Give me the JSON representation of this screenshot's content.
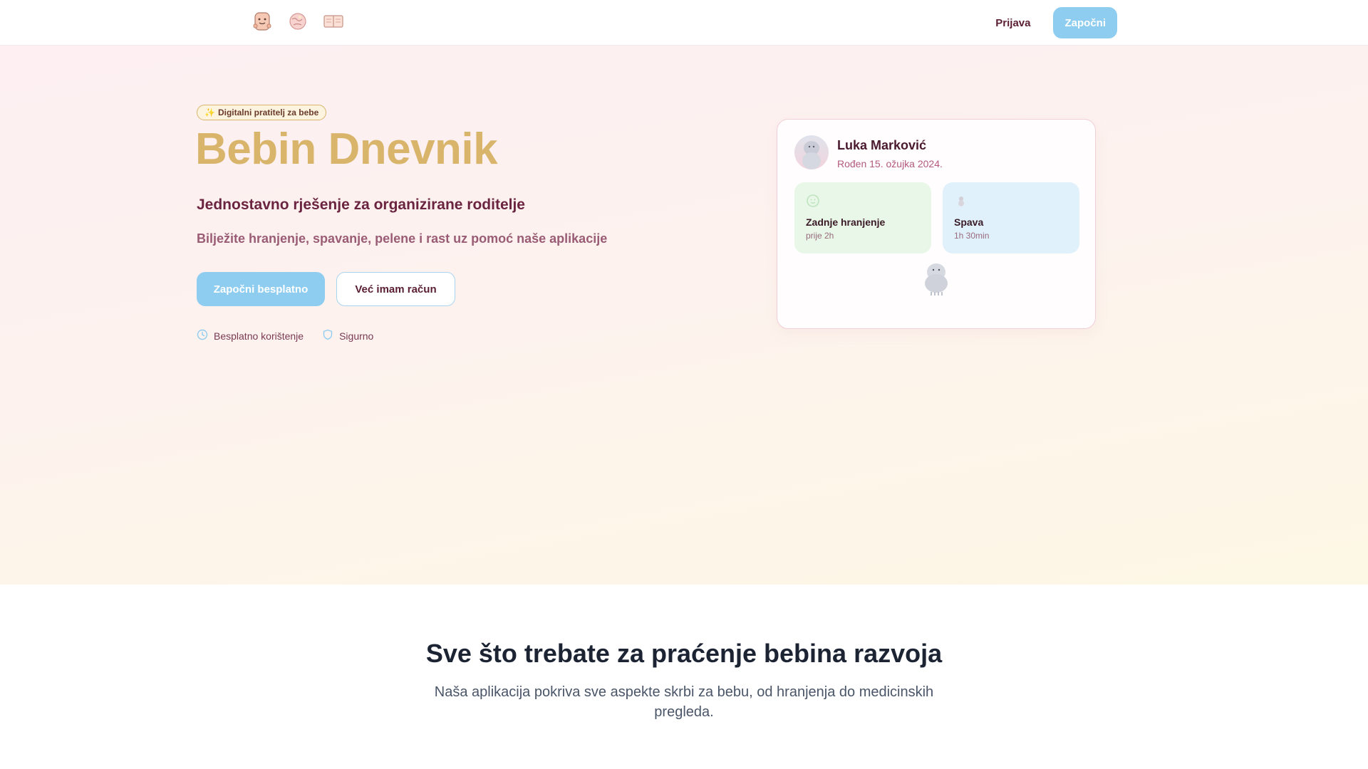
{
  "nav": {
    "logos": [
      "toast-logo-icon",
      "globe-logo-icon",
      "book-logo-icon"
    ],
    "login_label": "Prijava",
    "start_label": "Započni"
  },
  "hero": {
    "badge": "Digitalni pratitelj za bebe",
    "title": "Bebin Dnevnik",
    "subtitle": "Jednostavno rješenje za organizirane roditelje",
    "description": "Bilježite hranjenje, spavanje, pelene i rast uz pomoć naše aplikacije",
    "cta_primary": "Započni besplatno",
    "cta_secondary": "Već imam račun",
    "features": [
      {
        "icon": "clock-icon",
        "label": "Besplatno korištenje"
      },
      {
        "icon": "shield-icon",
        "label": "Sigurno"
      }
    ]
  },
  "profile_card": {
    "name": "Luka Marković",
    "born": "Rođen 15. ožujka 2024.",
    "stats": [
      {
        "icon": "feeding-icon",
        "label": "Zadnje hranjenje",
        "value": "prije 2h"
      },
      {
        "icon": "sleep-icon",
        "label": "Spava",
        "value": "1h 30min"
      }
    ]
  },
  "features_section": {
    "title": "Sve što trebate za praćenje bebina razvoja",
    "description": "Naša aplikacija pokriva sve aspekte skrbi za bebu, od hranjenja do medicinskih pregleda."
  },
  "colors": {
    "accent_blue": "#8ecdf0",
    "title_gold": "#d9b46b",
    "text_maroon": "#5a1e33",
    "feed_bg": "#e8f7e8",
    "sleep_bg": "#e0f1fb"
  }
}
